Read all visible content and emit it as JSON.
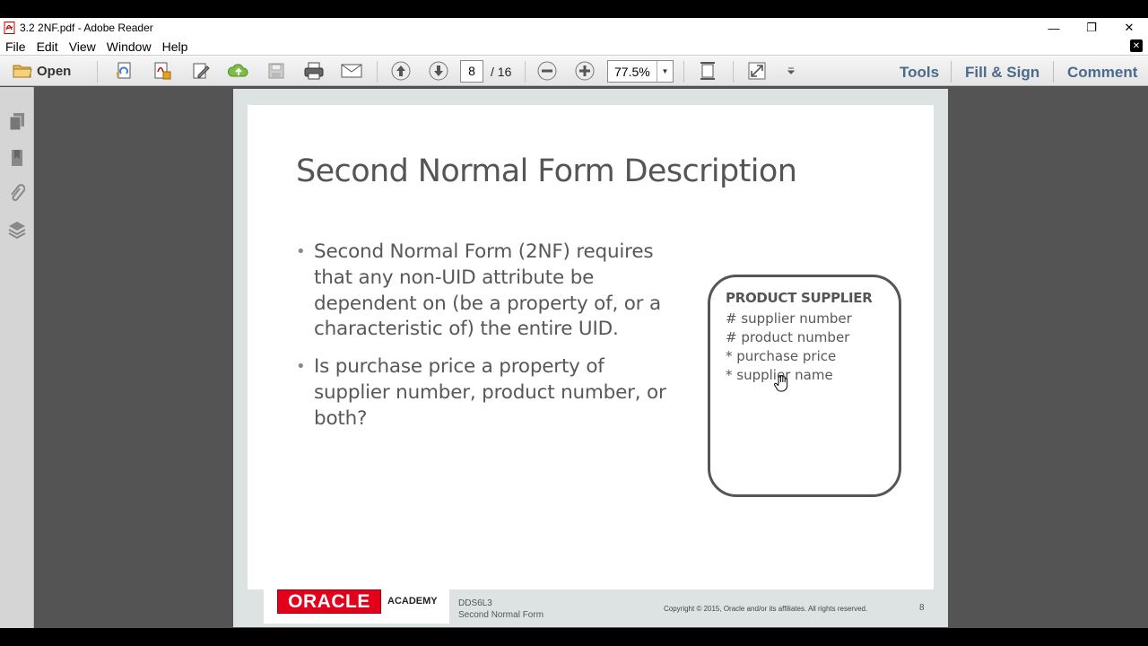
{
  "window": {
    "title": "3.2 2NF.pdf - Adobe Reader",
    "minimize": "—",
    "restore": "❐",
    "close": "✕"
  },
  "menu": [
    "File",
    "Edit",
    "View",
    "Window",
    "Help"
  ],
  "toolbar": {
    "open_label": "Open",
    "current_page": "8",
    "page_total": "/ 16",
    "zoom": "77.5%",
    "tabs": [
      "Tools",
      "Fill & Sign",
      "Comment"
    ],
    "icons": [
      "create-pdf-icon",
      "convert-pdf-icon",
      "edit-pdf-icon",
      "cloud-upload-icon",
      "save-icon",
      "print-icon",
      "email-icon",
      "previous-page-icon",
      "next-page-icon",
      "zoom-out-icon",
      "zoom-in-icon",
      "fit-page-icon",
      "full-screen-icon",
      "customize-icon"
    ],
    "accent_color": "#4a6a8e"
  },
  "nav_pane": {
    "icons": [
      "page-thumbnails-icon",
      "bookmarks-icon",
      "attachments-icon",
      "layers-icon"
    ]
  },
  "slide": {
    "title": "Second Normal Form Description",
    "bullets": [
      "Second Normal Form (2NF) requires that any non-UID attribute be dependent on (be a property of, or a characteristic of) the entire UID.",
      "Is purchase price a property of supplier number, product number, or both?"
    ],
    "entity": {
      "name": "PRODUCT SUPPLIER",
      "attributes": [
        "# supplier number",
        "# product number",
        "* purchase price",
        "* supplier name"
      ]
    },
    "footer": {
      "logo_text": "ORACLE",
      "academy": "ACADEMY",
      "course_code": "DDS6L3",
      "course_title": "Second Normal Form",
      "copyright": "Copyright © 2015, Oracle and/or its affiliates. All rights reserved.",
      "page_number": "8"
    }
  }
}
